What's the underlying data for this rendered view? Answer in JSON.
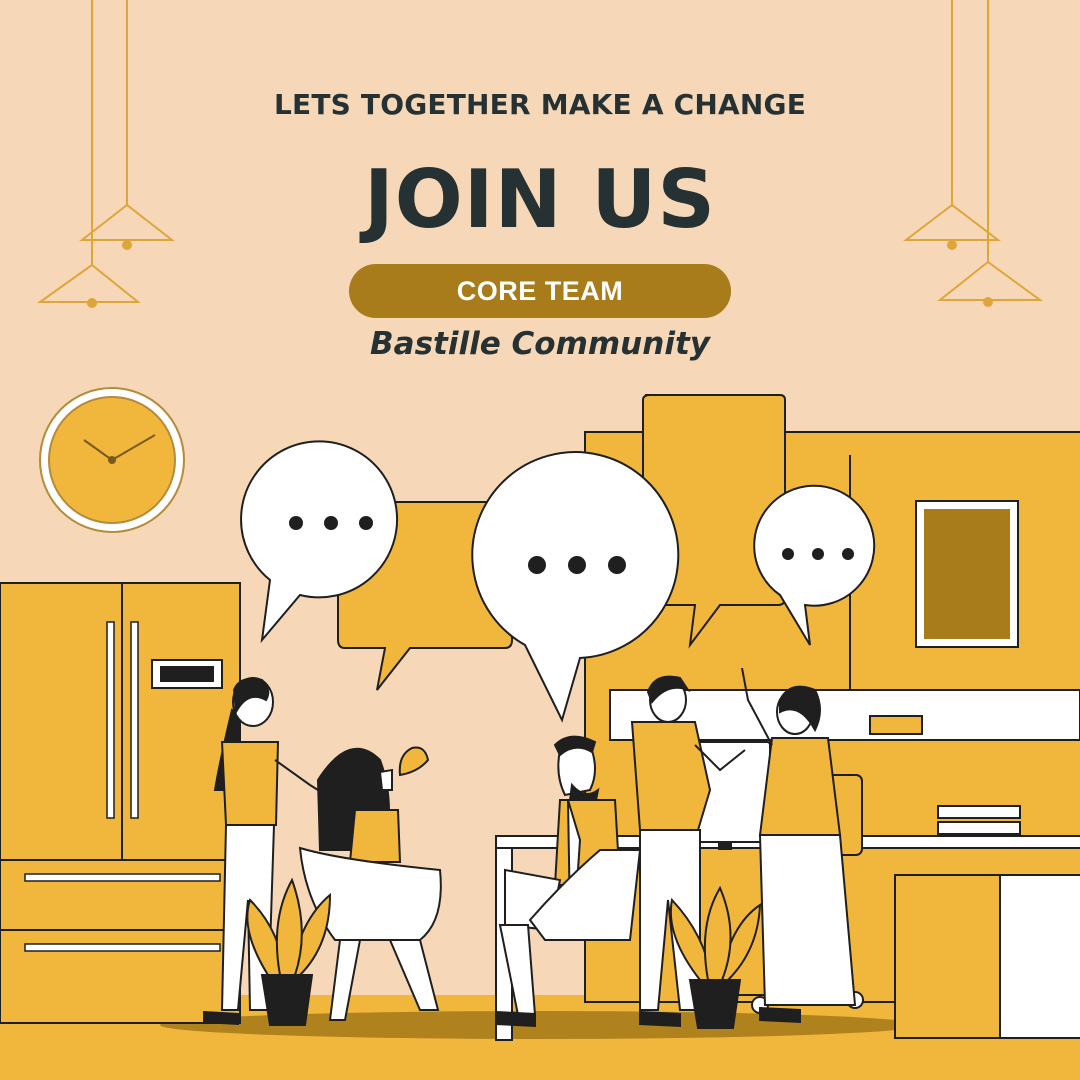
{
  "poster": {
    "tagline": "LETS TOGETHER MAKE A CHANGE",
    "headline": "JOIN US",
    "badge": "CORE TEAM",
    "organization": "Bastille Community"
  },
  "illustration": {
    "scene": "office-team-conversation",
    "icons": [
      "pendant-lamp-icon",
      "wall-clock-icon",
      "speech-bubble-icon",
      "refrigerator-icon",
      "potted-plant-icon",
      "desk-icon",
      "chair-icon",
      "computer-monitor-icon"
    ]
  },
  "colors": {
    "background": "#f6d8b8",
    "primary_yellow": "#f1b63c",
    "dark_gold": "#a87c1a",
    "text_dark": "#263133",
    "outline": "#1f1f1f",
    "white": "#ffffff"
  }
}
